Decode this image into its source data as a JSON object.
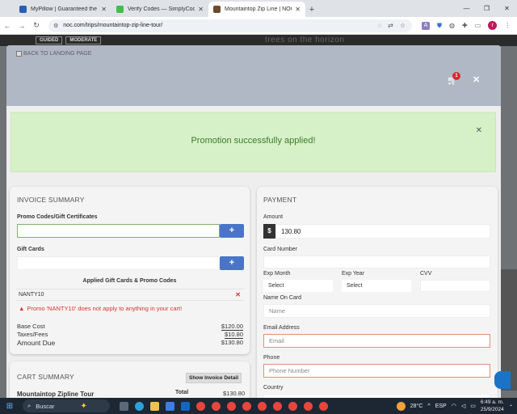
{
  "browser": {
    "tabs": [
      {
        "title": "MyPillow | Guaranteed the Mo",
        "favicon_color": "#2b5fb3",
        "active": false
      },
      {
        "title": "Verify Codes — SimplyCodes",
        "favicon_color": "#3fbf4a",
        "active": false
      },
      {
        "title": "Mountaintop Zip Line | NOC Z",
        "favicon_color": "#6b4b2b",
        "active": true
      }
    ],
    "url": "noc.com/trips/mountaintop-zip-line-tour/",
    "avatar_letter": "r",
    "ext_letter": "A"
  },
  "background_page": {
    "pill1": "GUIDED",
    "pill2": "MODERATE",
    "horizon_text": "trees on the horizon"
  },
  "modal": {
    "back_link": "BACK TO LANDING PAGE",
    "cart_count": "1",
    "promo_message": "Promotion successfully applied!",
    "invoice": {
      "title": "INVOICE SUMMARY",
      "promo_label": "Promo Codes/Gift Certificates",
      "gift_label": "Gift Cards",
      "applied_title": "Applied Gift Cards & Promo Codes",
      "applied_code": "NANTY10",
      "warning": "Promo 'NANTY10' does not apply to anything in your cart!",
      "base_cost_label": "Base Cost",
      "base_cost": "$120.00",
      "taxes_label": "Taxes/Fees",
      "taxes": "$10.80",
      "amount_due_label": "Amount Due",
      "amount_due": "$130.80"
    },
    "cart_summary": {
      "title": "CART SUMMARY",
      "show_detail": "Show Invoice Detail",
      "item": "Mountaintop Zipline Tour",
      "total_label": "Total",
      "total": "$130.80"
    },
    "payment": {
      "title": "PAYMENT",
      "amount_label": "Amount",
      "currency": "$",
      "amount": "130.80",
      "card_number_label": "Card Number",
      "exp_month_label": "Exp Month",
      "exp_year_label": "Exp Year",
      "cvv_label": "CVV",
      "select_text": "Select",
      "name_label": "Name On Card",
      "name_placeholder": "Name",
      "email_label": "Email Address",
      "email_placeholder": "Email",
      "phone_label": "Phone",
      "phone_placeholder": "Phone Number",
      "country_label": "Country"
    }
  },
  "taskbar": {
    "search": "Buscar",
    "temp": "28°C",
    "lang": "ESP",
    "time": "6:49 a. m.",
    "date": "25/9/2024"
  }
}
